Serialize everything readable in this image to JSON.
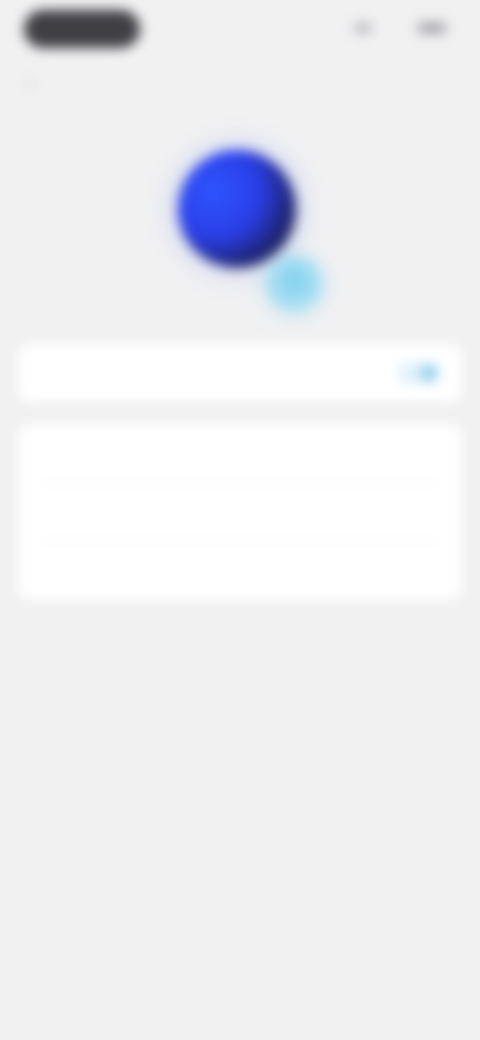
{
  "status_bar": {
    "left_pill": "",
    "right_text": ""
  },
  "header": {
    "title": ""
  },
  "toggle_row": {
    "label": "",
    "value": ""
  },
  "info_rows": [
    {
      "label": "",
      "value": ""
    },
    {
      "label": "",
      "value": ""
    },
    {
      "label": "",
      "value": ""
    }
  ],
  "colors": {
    "background": "#f1f1f2",
    "card": "#ffffff",
    "avatar_primary": "#2f54ff",
    "avatar_dark": "#17183b",
    "badge": "#7fd0f0",
    "toggle_track": "#dff1fb",
    "toggle_knob": "#8dcde9"
  }
}
